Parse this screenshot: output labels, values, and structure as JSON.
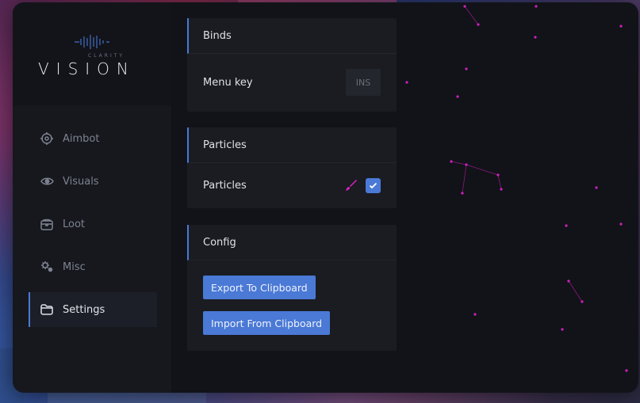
{
  "logo": {
    "title": "VISION",
    "subtitle": "CLARITY"
  },
  "sidebar": {
    "items": [
      {
        "label": "Aimbot",
        "icon": "crosshair-icon"
      },
      {
        "label": "Visuals",
        "icon": "eye-icon"
      },
      {
        "label": "Loot",
        "icon": "chest-icon"
      },
      {
        "label": "Misc",
        "icon": "gears-icon"
      },
      {
        "label": "Settings",
        "icon": "folder-icon",
        "active": true
      }
    ]
  },
  "sections": {
    "binds": {
      "title": "Binds",
      "menu_key_label": "Menu key",
      "menu_key_value": "INS"
    },
    "particles": {
      "title": "Particles",
      "particles_label": "Particles",
      "particles_enabled": true,
      "color_picker_icon": "brush-icon",
      "particle_color": "#e020c0"
    },
    "config": {
      "title": "Config",
      "export_label": "Export To Clipboard",
      "import_label": "Import From Clipboard"
    }
  },
  "colors": {
    "accent": "#4a79d6",
    "particle": "#d21fc0",
    "panel": "#1a1c22",
    "window": "#111318"
  }
}
